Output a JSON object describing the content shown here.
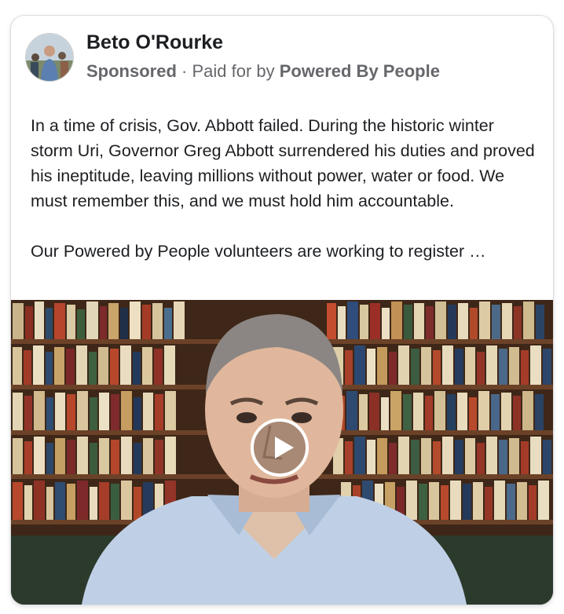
{
  "post": {
    "author_name": "Beto O'Rourke",
    "sponsored_label": "Sponsored",
    "separator": " · ",
    "paid_for_label": "Paid for by ",
    "payer_name": "Powered By People",
    "body_paragraph_1": "In a time of crisis, Gov. Abbott failed. During the historic winter storm Uri, Governor Greg Abbott surrendered his duties and proved his ineptitude, leaving millions without power, water or food. We must remember this, and we must hold him accountable.",
    "body_paragraph_2": "Our Powered by People volunteers are working to register …"
  },
  "video": {
    "play_icon": "play-icon"
  },
  "colors": {
    "text_primary": "#1c1e21",
    "text_secondary": "#65676b",
    "card_border": "#dadde1"
  }
}
